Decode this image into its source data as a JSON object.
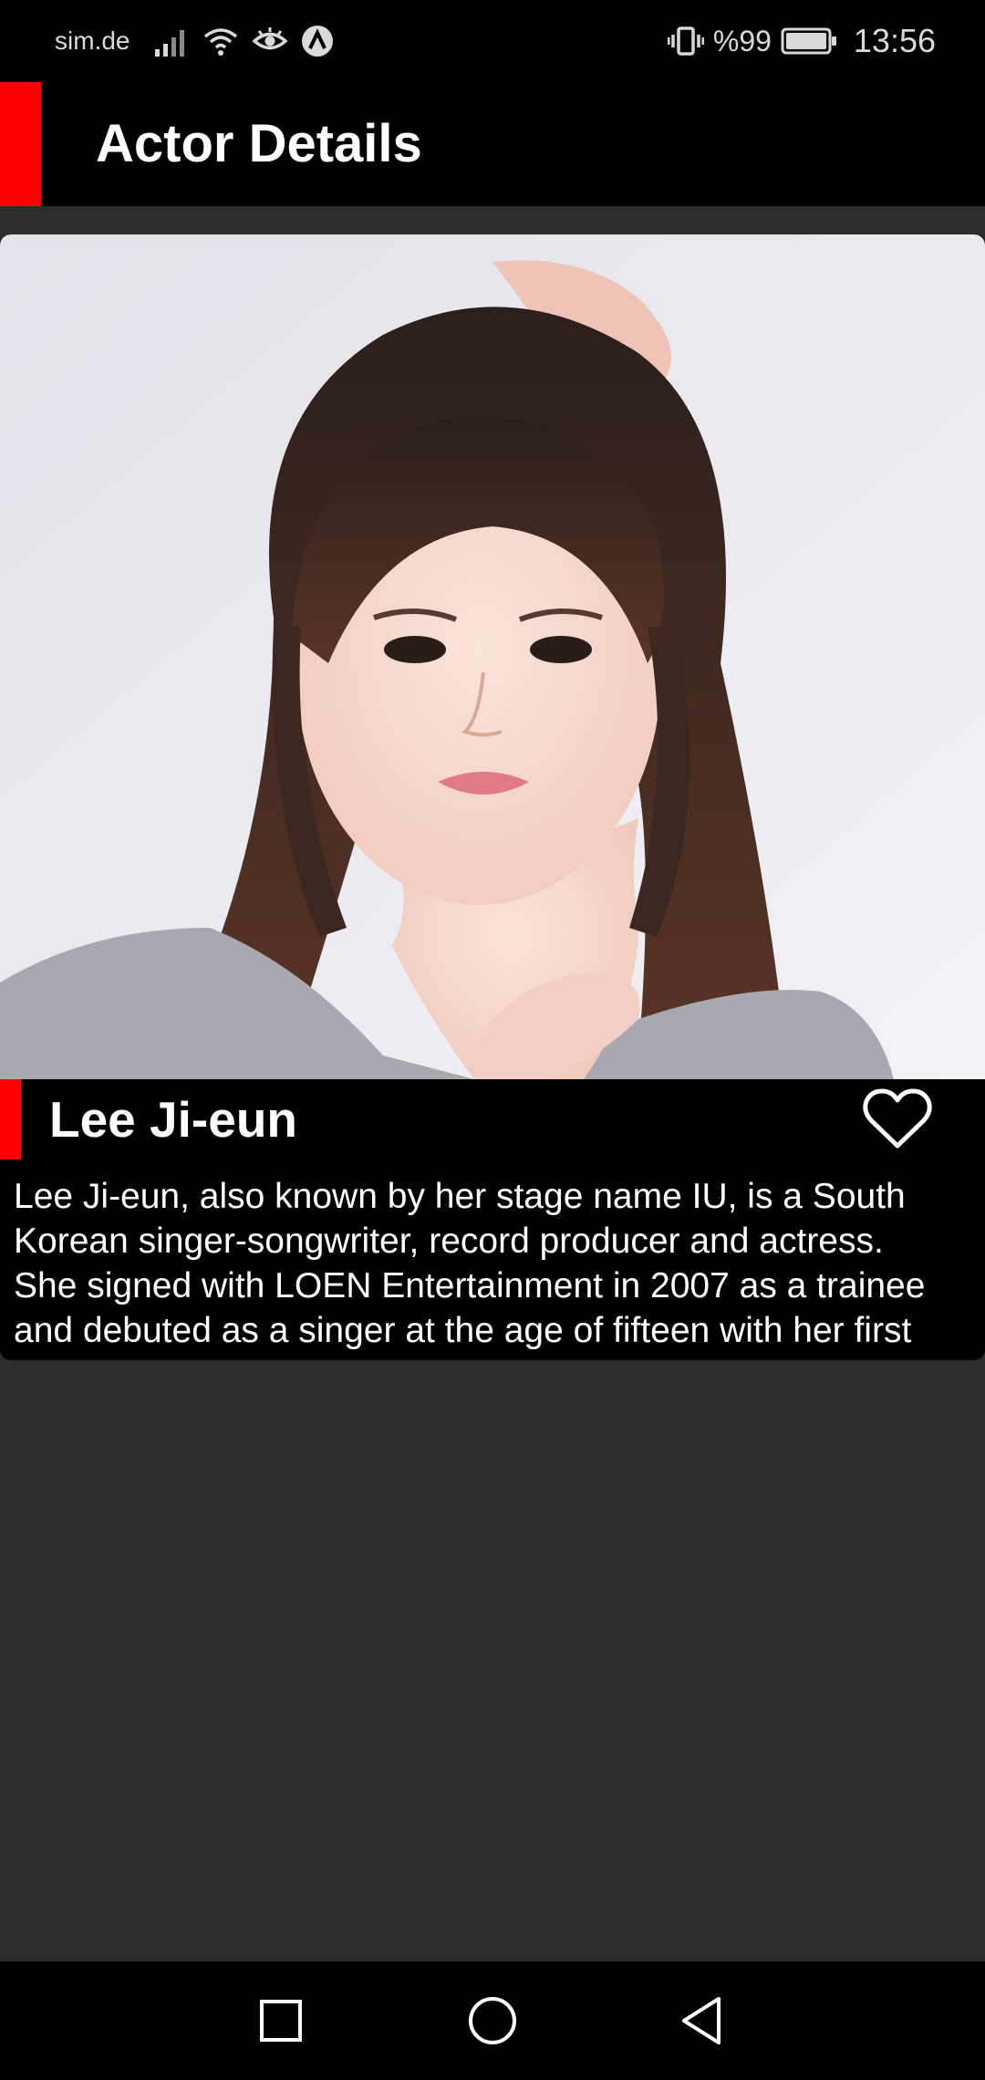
{
  "status_bar": {
    "carrier": "sim.de",
    "battery_text": "%99",
    "time": "13:56",
    "icons": [
      "signal-icon",
      "wifi-icon",
      "eye-icon",
      "app-notification-icon",
      "vibrate-icon",
      "battery-icon"
    ]
  },
  "app_bar": {
    "title": "Actor Details",
    "accent_color": "#ff0000"
  },
  "actor": {
    "name": "Lee Ji-eun",
    "favorite_icon": "heart-outline-icon",
    "bio": "Lee Ji-eun, also known by her stage name IU, is a South\nKorean singer-songwriter, record producer and actress.\nShe signed with LOEN Entertainment in 2007 as a trainee\nand debuted as a singer at the age of fifteen with her first"
  },
  "nav_bar": {
    "buttons": [
      "recents-square-icon",
      "home-circle-icon",
      "back-triangle-icon"
    ]
  },
  "colors": {
    "background": "#2c2c2c",
    "bar": "#000000",
    "accent": "#ff0000",
    "text": "#ffffff"
  }
}
